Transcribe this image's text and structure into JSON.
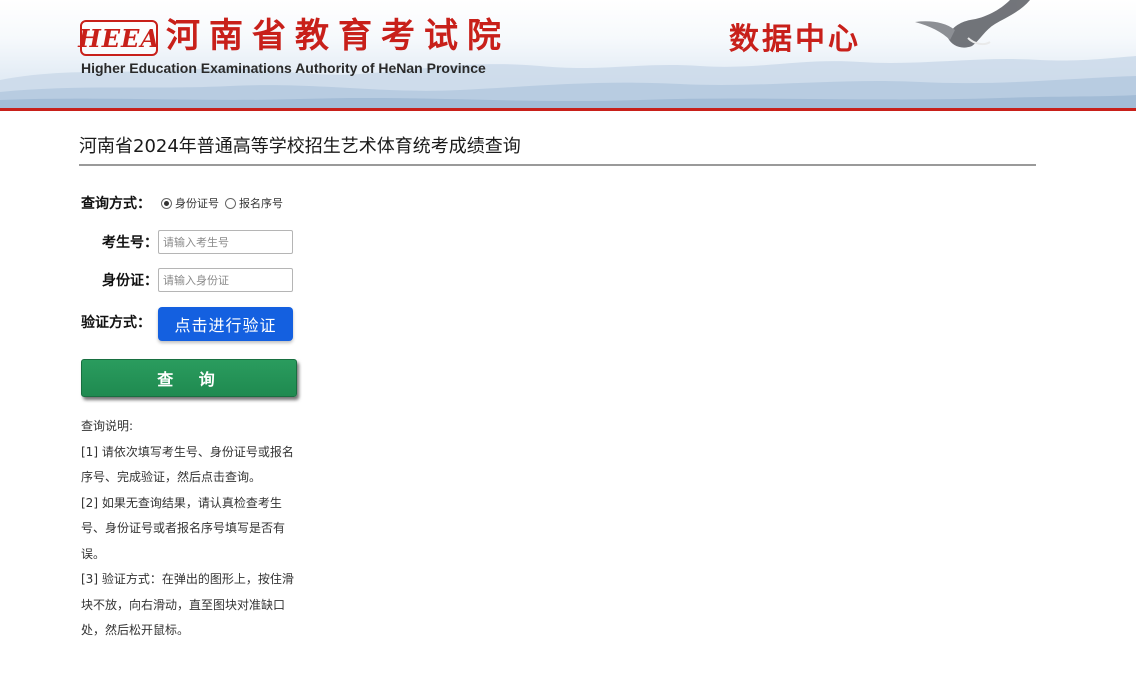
{
  "header": {
    "logo_text": "HEEA",
    "org_name": "河南省教育考试院",
    "org_name_en": "Higher Education Examinations Authority of HeNan Province",
    "center_name": "数据中心",
    "brand_color": "#c8201a"
  },
  "page": {
    "title": "河南省2024年普通高等学校招生艺术体育统考成绩查询"
  },
  "form": {
    "query_method_label": "查询方式：",
    "query_method_options": [
      {
        "label": "身份证号",
        "selected": true
      },
      {
        "label": "报名序号",
        "selected": false
      }
    ],
    "exam_no_label": "考生号：",
    "exam_no_placeholder": "请输入考生号",
    "exam_no_value": "",
    "id_label": "身份证：",
    "id_placeholder": "请输入身份证",
    "id_value": "",
    "verify_label": "验证方式：",
    "verify_button": "点击进行验证",
    "query_button": "查 询"
  },
  "notes": {
    "heading": "查询说明:",
    "items": [
      "[1] 请依次填写考生号、身份证号或报名序号、完成验证，然后点击查询。",
      "[2] 如果无查询结果，请认真检查考生号、身份证号或者报名序号填写是否有误。",
      "[3] 验证方式：在弹出的图形上，按住滑块不放，向右滑动，直至图块对准缺口处，然后松开鼠标。"
    ]
  },
  "colors": {
    "verify_button": "#1460e0",
    "query_button": "#1f8a50"
  }
}
